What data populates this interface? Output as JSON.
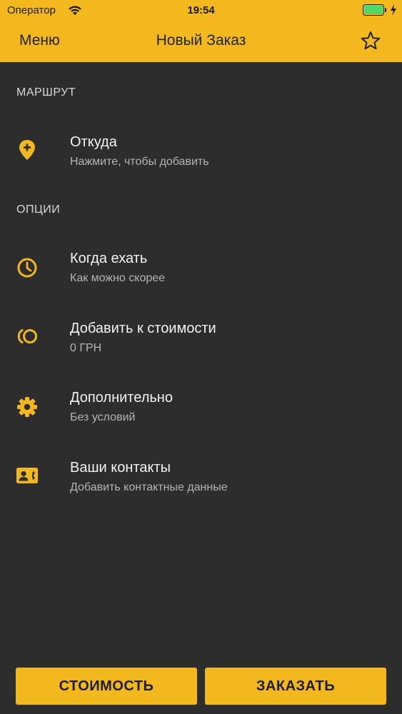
{
  "status_bar": {
    "carrier": "Оператор",
    "time": "19:54"
  },
  "nav": {
    "menu_label": "Меню",
    "title": "Новый Заказ",
    "star_icon": "star-outline-icon"
  },
  "sections": {
    "route_header": "МАРШРУТ",
    "options_header": "ОПЦИИ"
  },
  "route": {
    "from": {
      "icon": "location-add-icon",
      "title": "Откуда",
      "subtitle": "Нажмите, чтобы добавить"
    }
  },
  "options": {
    "when": {
      "icon": "clock-icon",
      "title": "Когда ехать",
      "subtitle": "Как можно скорее"
    },
    "add_cost": {
      "icon": "coins-icon",
      "title": "Добавить к стоимости",
      "subtitle": "0 ГРН"
    },
    "extra": {
      "icon": "gear-icon",
      "title": "Дополнительно",
      "subtitle": "Без условий"
    },
    "contacts": {
      "icon": "contact-card-icon",
      "title": "Ваши контакты",
      "subtitle": "Добавить контактные данные"
    }
  },
  "buttons": {
    "cost": "СТОИМОСТЬ",
    "order": "ЗАКАЗАТЬ"
  },
  "colors": {
    "accent": "#f2b81e",
    "background": "#2d2d2d",
    "battery_fill": "#4cd964"
  }
}
